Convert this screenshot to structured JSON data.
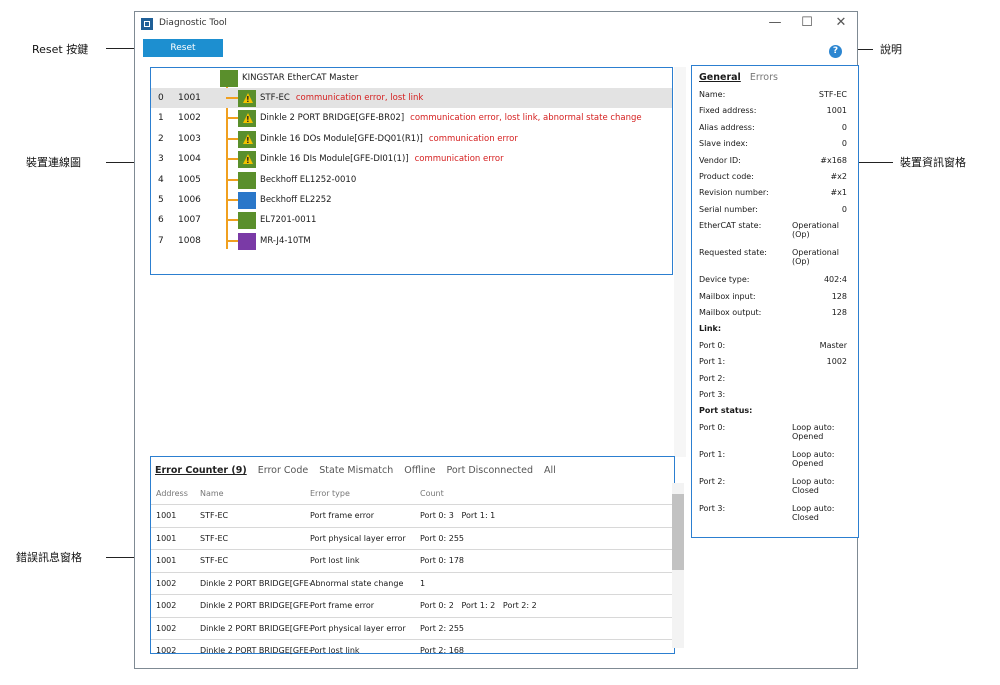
{
  "window": {
    "title": "Diagnostic Tool",
    "minimize": "—",
    "maximize": "☐",
    "close": "✕"
  },
  "toolbar": {
    "reset_label": "Reset",
    "help_symbol": "?"
  },
  "annotations": {
    "reset": "Reset 按鍵",
    "help": "說明",
    "topology": "裝置連線圖",
    "info": "裝置資訊窗格",
    "errors": "錯誤訊息窗格"
  },
  "topology": {
    "master": "KINGSTAR EtherCAT Master",
    "devices": [
      {
        "index": "0",
        "address": "1001",
        "name": "STF-EC",
        "error": "communication error, lost link",
        "color": "#5a8f2c",
        "warn": true,
        "selected": true
      },
      {
        "index": "1",
        "address": "1002",
        "name": "Dinkle 2 PORT BRIDGE[GFE-BR02]",
        "error": "communication error, lost link, abnormal state change",
        "color": "#5a8f2c",
        "warn": true,
        "selected": false
      },
      {
        "index": "2",
        "address": "1003",
        "name": "Dinkle 16 DOs Module[GFE-DQ01(R1)]",
        "error": "communication error",
        "color": "#5a8f2c",
        "warn": true,
        "selected": false
      },
      {
        "index": "3",
        "address": "1004",
        "name": "Dinkle 16 DIs Module[GFE-DI01(1)]",
        "error": "communication error",
        "color": "#5a8f2c",
        "warn": true,
        "selected": false
      },
      {
        "index": "4",
        "address": "1005",
        "name": "Beckhoff EL1252-0010",
        "error": "",
        "color": "#5a8f2c",
        "warn": false,
        "selected": false
      },
      {
        "index": "5",
        "address": "1006",
        "name": "Beckhoff EL2252",
        "error": "",
        "color": "#2a77c9",
        "warn": false,
        "selected": false
      },
      {
        "index": "6",
        "address": "1007",
        "name": "EL7201-0011",
        "error": "",
        "color": "#5a8f2c",
        "warn": false,
        "selected": false
      },
      {
        "index": "7",
        "address": "1008",
        "name": "MR-J4-10TM",
        "error": "",
        "color": "#7a3aa6",
        "warn": false,
        "selected": false
      }
    ]
  },
  "info": {
    "tabs": [
      "General",
      "Errors"
    ],
    "rows": [
      {
        "k": "Name:",
        "v": "STF-EC"
      },
      {
        "k": "Fixed address:",
        "v": "1001"
      },
      {
        "k": "Alias address:",
        "v": "0"
      },
      {
        "k": "Slave index:",
        "v": "0"
      },
      {
        "k": "Vendor ID:",
        "v": "#x168"
      },
      {
        "k": "Product code:",
        "v": "#x2"
      },
      {
        "k": "Revision number:",
        "v": "#x1"
      },
      {
        "k": "Serial number:",
        "v": "0"
      },
      {
        "k": "EtherCAT state:",
        "v": "Operational (Op)"
      },
      {
        "k": "Requested state:",
        "v": "Operational (Op)"
      },
      {
        "k": "Device type:",
        "v": "402:4"
      },
      {
        "k": "Mailbox input:",
        "v": "128"
      },
      {
        "k": "Mailbox output:",
        "v": "128"
      },
      {
        "k": "Link:",
        "v": ""
      },
      {
        "k": "Port 0:",
        "v": "Master"
      },
      {
        "k": "Port 1:",
        "v": "1002"
      },
      {
        "k": "Port 2:",
        "v": ""
      },
      {
        "k": "Port 3:",
        "v": ""
      },
      {
        "k": "Port status:",
        "v": ""
      },
      {
        "k": "Port 0:",
        "v": "Loop auto: Opened"
      },
      {
        "k": "Port 1:",
        "v": "Loop auto: Opened"
      },
      {
        "k": "Port 2:",
        "v": "Loop auto: Closed"
      },
      {
        "k": "Port 3:",
        "v": "Loop auto: Closed"
      }
    ]
  },
  "errors": {
    "tabs": [
      "Error Counter (9)",
      "Error Code",
      "State Mismatch",
      "Offline",
      "Port Disconnected",
      "All"
    ],
    "headers": [
      "Address",
      "Name",
      "Error type",
      "Count"
    ],
    "rows": [
      {
        "address": "1001",
        "name": "STF-EC",
        "type": "Port frame error",
        "count": "Port 0: 3   Port 1: 1"
      },
      {
        "address": "1001",
        "name": "STF-EC",
        "type": "Port physical layer error",
        "count": "Port 0: 255"
      },
      {
        "address": "1001",
        "name": "STF-EC",
        "type": "Port lost link",
        "count": "Port 0: 178"
      },
      {
        "address": "1002",
        "name": "Dinkle 2 PORT BRIDGE[GFE-",
        "type": "Abnormal state change",
        "count": "1"
      },
      {
        "address": "1002",
        "name": "Dinkle 2 PORT BRIDGE[GFE-",
        "type": "Port frame error",
        "count": "Port 0: 2   Port 1: 2   Port 2: 2"
      },
      {
        "address": "1002",
        "name": "Dinkle 2 PORT BRIDGE[GFE-",
        "type": "Port physical layer error",
        "count": "Port 2: 255"
      },
      {
        "address": "1002",
        "name": "Dinkle 2 PORT BRIDGE[GFE-",
        "type": "Port lost link",
        "count": "Port 2: 168"
      }
    ]
  }
}
